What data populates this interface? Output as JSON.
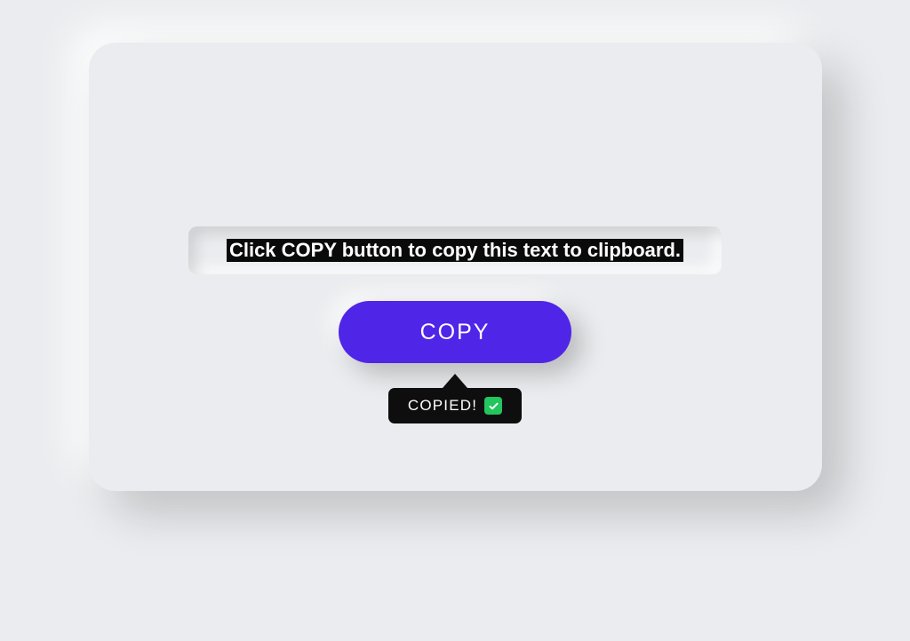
{
  "textWell": {
    "content": "Click COPY button to copy this text to clipboard."
  },
  "button": {
    "label": "COPY"
  },
  "tooltip": {
    "label": "COPIED!"
  }
}
